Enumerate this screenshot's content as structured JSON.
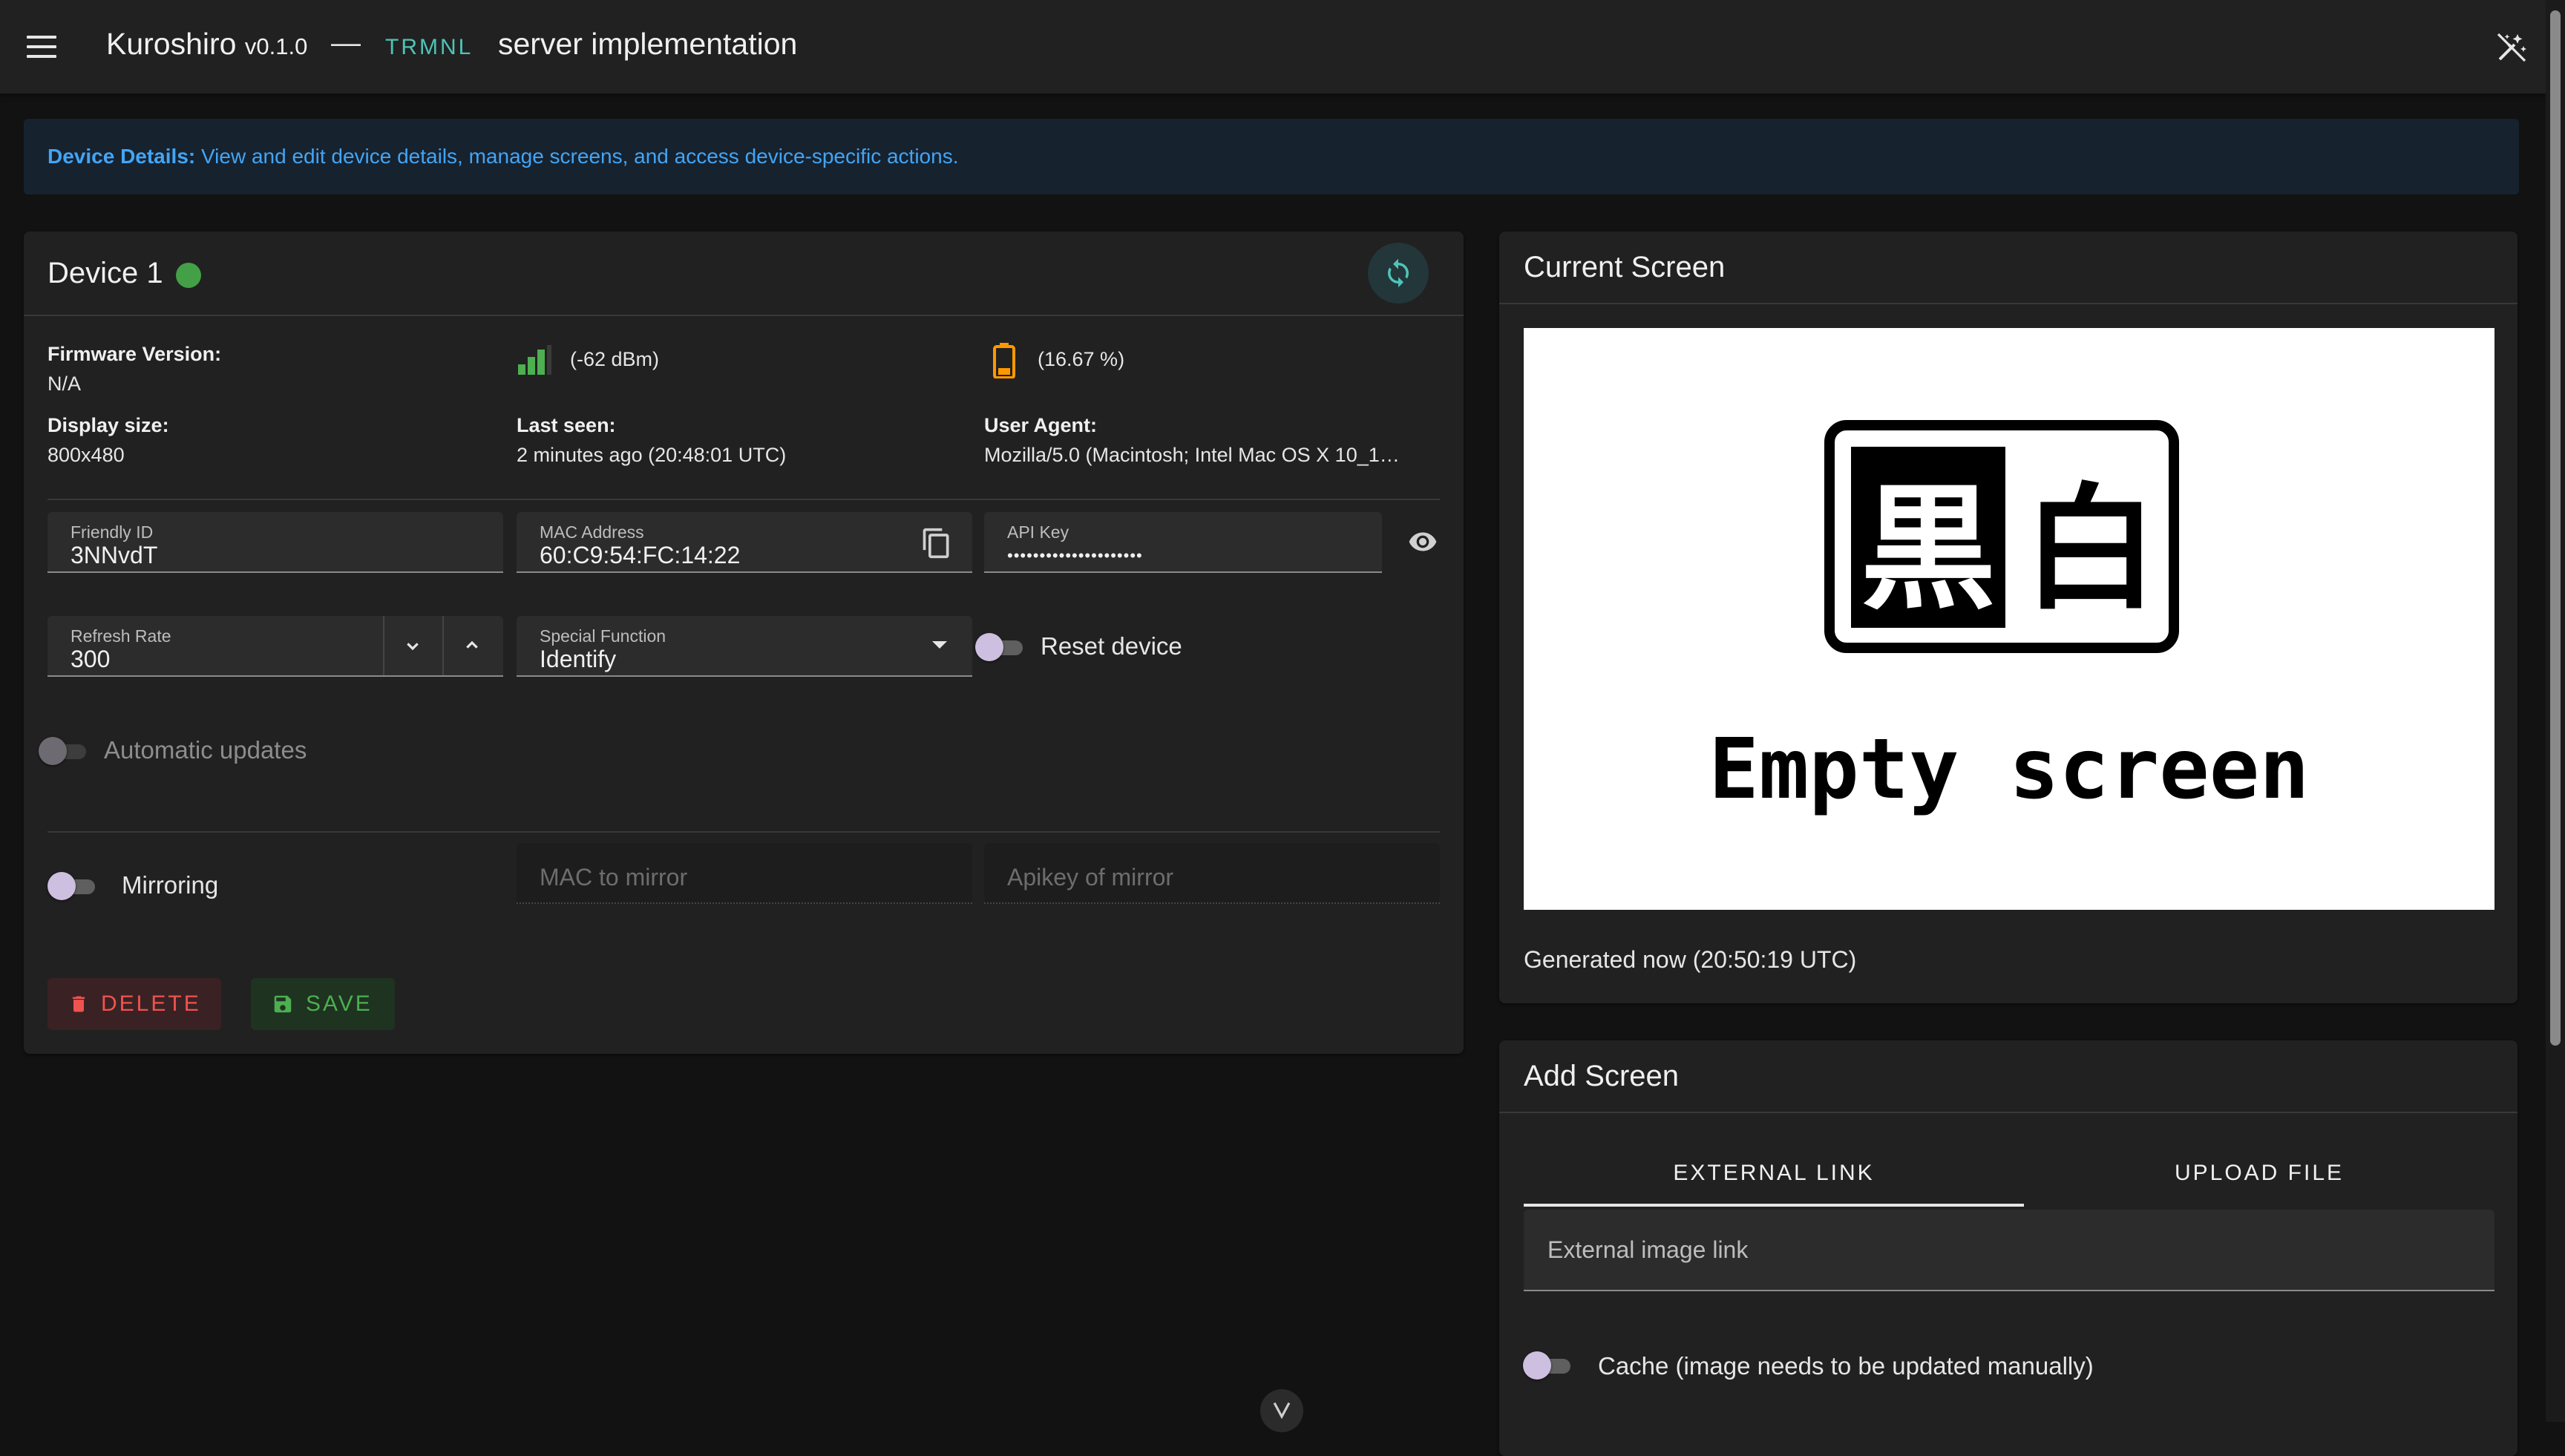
{
  "appbar": {
    "title": "Kuroshiro",
    "version": "v0.1.0",
    "dash": "—",
    "brand": "TRMNL",
    "subtitle": "server implementation"
  },
  "banner": {
    "label": "Device Details:",
    "text": "View and edit device details, manage screens, and access device-specific actions."
  },
  "device": {
    "name": "Device 1",
    "status_color": "#43a047",
    "firmware_label": "Firmware Version:",
    "firmware_value": "N/A",
    "signal_value": "(-62 dBm)",
    "battery_value": "(16.67 %)",
    "display_label": "Display size:",
    "display_value": "800x480",
    "last_seen_label": "Last seen:",
    "last_seen_value": "2 minutes ago (20:48:01 UTC)",
    "user_agent_label": "User Agent:",
    "user_agent_value": "Mozilla/5.0 (Macintosh; Intel Mac OS X 10_1…",
    "friendly_id_label": "Friendly ID",
    "friendly_id_value": "3NNvdT",
    "mac_label": "MAC Address",
    "mac_value": "60:C9:54:FC:14:22",
    "api_key_label": "API Key",
    "api_key_value": "•••••••••••••••••••••",
    "refresh_label": "Refresh Rate",
    "refresh_value": "300",
    "special_label": "Special Function",
    "special_value": "Identify",
    "reset_label": "Reset device",
    "auto_updates_label": "Automatic updates",
    "mirroring_label": "Mirroring",
    "mac_mirror_placeholder": "MAC to mirror",
    "apikey_mirror_placeholder": "Apikey of mirror",
    "delete_label": "DELETE",
    "save_label": "SAVE"
  },
  "current_screen": {
    "title": "Current Screen",
    "image_kanji_left": "黒",
    "image_kanji_right": "白",
    "image_caption": "Empty screen",
    "generated": "Generated now (20:50:19 UTC)"
  },
  "add_screen": {
    "title": "Add Screen",
    "tabs": [
      {
        "label": "EXTERNAL LINK",
        "active": true
      },
      {
        "label": "UPLOAD FILE",
        "active": false
      }
    ],
    "external_placeholder": "External image link",
    "cache_label": "Cache (image needs to be updated manually)"
  },
  "colors": {
    "accent_teal": "#4fc3b8",
    "info_blue": "#42a5f5",
    "status_green": "#43a047",
    "battery_orange": "#ff9800",
    "delete_red": "#ef5350",
    "save_green": "#4caf50"
  }
}
